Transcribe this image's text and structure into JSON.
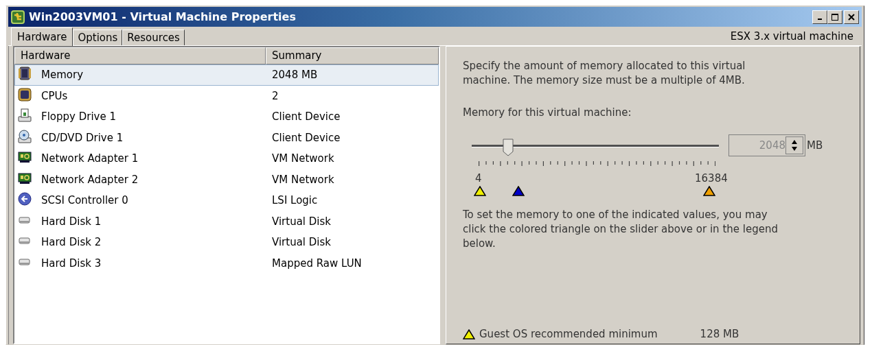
{
  "window": {
    "title": "Win2003VM01 - Virtual Machine Properties"
  },
  "tabs": [
    {
      "label": "Hardware",
      "selected": true
    },
    {
      "label": "Options",
      "selected": false
    },
    {
      "label": "Resources",
      "selected": false
    }
  ],
  "machine_version": "ESX 3.x virtual machine",
  "hardware_table": {
    "columns": [
      "Hardware",
      "Summary"
    ],
    "rows": [
      {
        "kind": "memory",
        "name": "Memory",
        "summary": "2048 MB",
        "selected": true
      },
      {
        "kind": "cpu",
        "name": "CPUs",
        "summary": "2",
        "selected": false
      },
      {
        "kind": "floppy",
        "name": "Floppy Drive 1",
        "summary": "Client Device",
        "selected": false
      },
      {
        "kind": "cdrom",
        "name": "CD/DVD Drive 1",
        "summary": "Client Device",
        "selected": false
      },
      {
        "kind": "network",
        "name": "Network Adapter 1",
        "summary": "VM Network",
        "selected": false
      },
      {
        "kind": "network",
        "name": "Network Adapter 2",
        "summary": "VM Network",
        "selected": false
      },
      {
        "kind": "scsi",
        "name": "SCSI Controller 0",
        "summary": "LSI Logic",
        "selected": false
      },
      {
        "kind": "disk",
        "name": "Hard Disk 1",
        "summary": "Virtual Disk",
        "selected": false
      },
      {
        "kind": "disk",
        "name": "Hard Disk 2",
        "summary": "Virtual Disk",
        "selected": false
      },
      {
        "kind": "disk",
        "name": "Hard Disk 3",
        "summary": "Mapped Raw LUN",
        "selected": false
      }
    ]
  },
  "memory_panel": {
    "intro": "Specify the amount of memory allocated to this virtual machine. The memory size must be a multiple of 4MB.",
    "slider_label": "Memory for this virtual machine:",
    "slider": {
      "level": 0.147,
      "value": "2048",
      "unit": "MB",
      "min_label": "4",
      "max_label": "16384"
    },
    "markers": [
      {
        "kind": "minimum",
        "color": "#f0f000"
      },
      {
        "kind": "current",
        "color": "#0000c8"
      },
      {
        "kind": "maximum",
        "color": "#f0a000"
      }
    ],
    "hint": "To set the memory to one of the indicated values, you may click the colored triangle on the slider above or in the legend below.",
    "legend": [
      {
        "color": "#f0f000",
        "label": "Guest OS recommended minimum",
        "value": "128 MB"
      }
    ]
  }
}
